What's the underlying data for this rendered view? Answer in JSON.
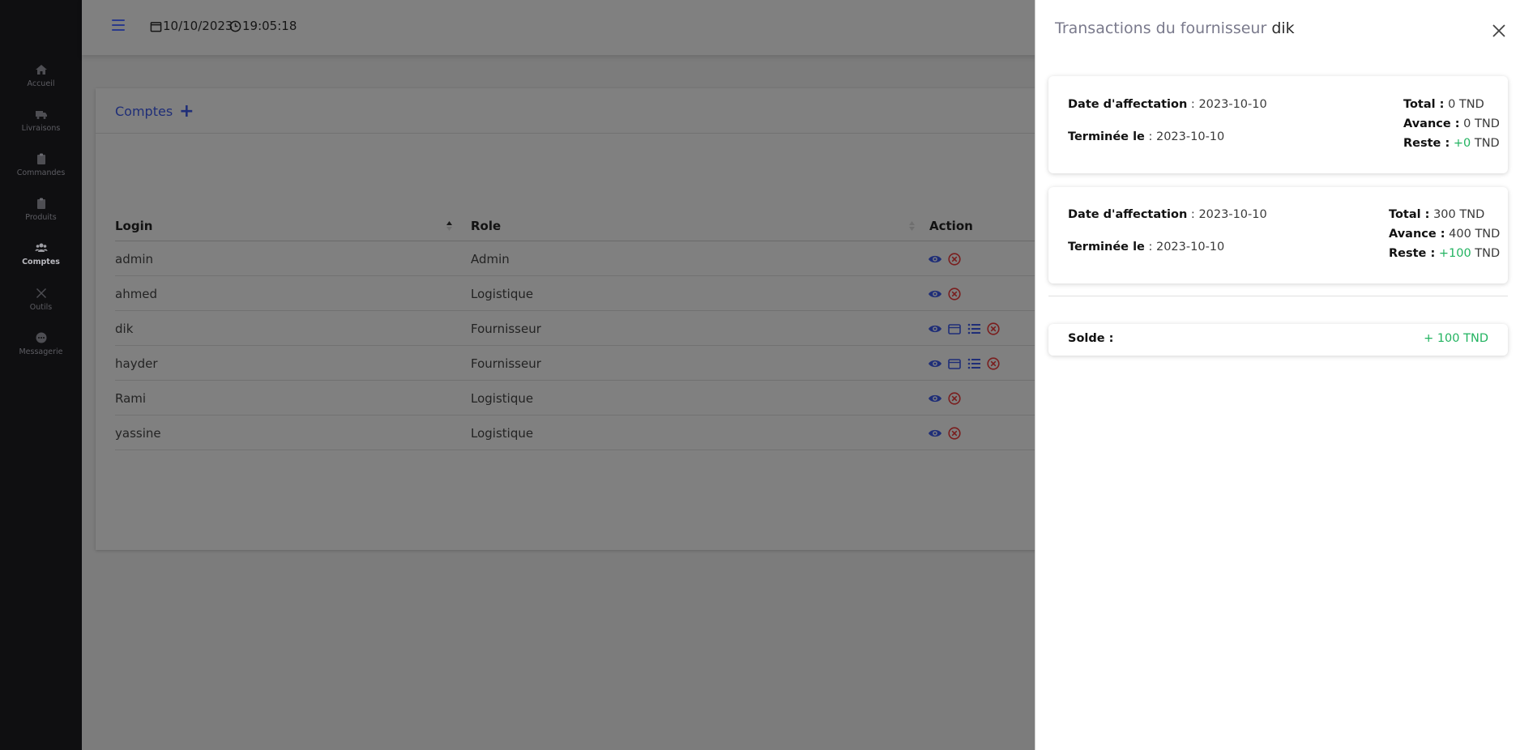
{
  "sidebar": {
    "items": [
      {
        "label": "Accueil",
        "icon": "home-icon"
      },
      {
        "label": "Livraisons",
        "icon": "truck-icon"
      },
      {
        "label": "Commandes",
        "icon": "clipboard-icon"
      },
      {
        "label": "Produits",
        "icon": "clipboard-icon"
      },
      {
        "label": "Comptes",
        "icon": "users-icon",
        "active": true
      },
      {
        "label": "Outils",
        "icon": "tools-icon"
      },
      {
        "label": "Messagerie",
        "icon": "chat-icon"
      }
    ]
  },
  "topbar": {
    "date": "10/10/2023",
    "time": "19:05:18"
  },
  "card": {
    "title": "Comptes",
    "add_symbol": "+"
  },
  "table": {
    "columns": [
      "Login",
      "Role",
      "Action"
    ],
    "rows": [
      {
        "login": "admin",
        "role": "Admin",
        "supplier": false
      },
      {
        "login": "ahmed",
        "role": "Logistique",
        "supplier": false
      },
      {
        "login": "dik",
        "role": "Fournisseur",
        "supplier": true
      },
      {
        "login": "hayder",
        "role": "Fournisseur",
        "supplier": true
      },
      {
        "login": "Rami",
        "role": "Logistique",
        "supplier": false
      },
      {
        "login": "yassine",
        "role": "Logistique",
        "supplier": false
      }
    ]
  },
  "panel": {
    "title_prefix": "Transactions du fournisseur",
    "supplier_name": "dik",
    "transactions": [
      {
        "date_label": "Date d'affectation",
        "date_value": "2023-10-10",
        "end_label": "Terminée le",
        "end_value": "2023-10-10",
        "total_label": "Total :",
        "total_value": "0 TND",
        "avance_label": "Avance :",
        "avance_value": "0 TND",
        "reste_label": "Reste :",
        "reste_value": "+0",
        "reste_unit": "TND"
      },
      {
        "date_label": "Date d'affectation",
        "date_value": "2023-10-10",
        "end_label": "Terminée le",
        "end_value": "2023-10-10",
        "total_label": "Total :",
        "total_value": "300 TND",
        "avance_label": "Avance :",
        "avance_value": "400 TND",
        "reste_label": "Reste :",
        "reste_value": "+100",
        "reste_unit": "TND"
      }
    ],
    "solde_label": "Solde :",
    "solde_value": "+ 100 TND"
  },
  "colors": {
    "accent": "#1f2e78",
    "positive": "#22b360",
    "danger": "#c0392b",
    "sidebar_bg": "#0f0f11"
  }
}
